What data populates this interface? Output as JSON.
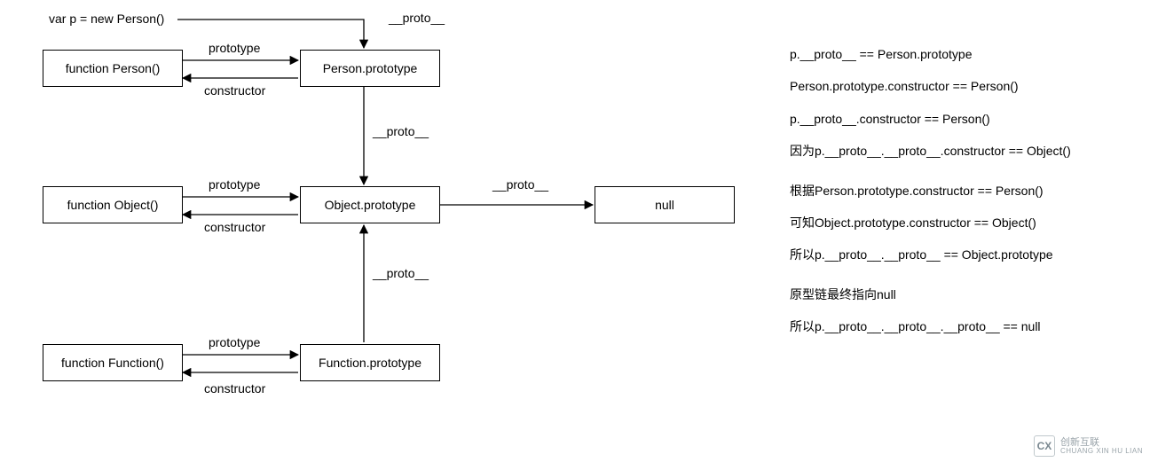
{
  "title_var": "var p = new Person()",
  "boxes": {
    "person_fn": "function Person()",
    "person_proto": "Person.prototype",
    "object_fn": "function Object()",
    "object_proto": "Object.prototype",
    "function_fn": "function Function()",
    "function_proto": "Function.prototype",
    "null_box": "null"
  },
  "labels": {
    "proto": "__proto__",
    "prototype": "prototype",
    "constructor": "constructor"
  },
  "notes": {
    "l1": "p.__proto__ == Person.prototype",
    "l2": "Person.prototype.constructor ==  Person()",
    "l3": "p.__proto__.constructor ==  Person()",
    "l4": "因为p.__proto__.__proto__.constructor == Object()",
    "l5": "根据Person.prototype.constructor == Person()",
    "l6": "可知Object.prototype.constructor == Object()",
    "l7": "所以p.__proto__.__proto__ == Object.prototype",
    "l8": "原型链最终指向null",
    "l9": "所以p.__proto__.__proto__.__proto__ == null"
  },
  "watermark": {
    "brand": "创新互联",
    "sub": "CHUANG XIN HU LIAN",
    "logo": "CX"
  }
}
